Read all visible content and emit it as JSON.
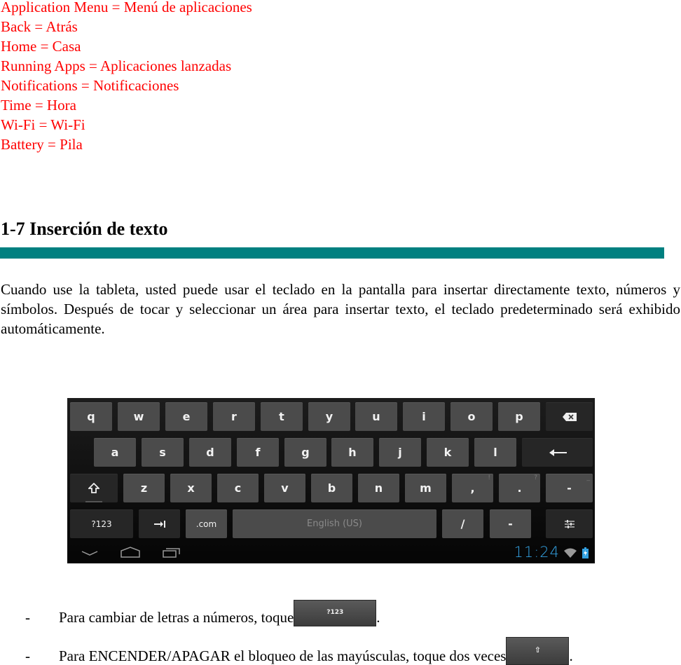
{
  "glossary": [
    "Application Menu = Menú de aplicaciones",
    "Back = Atrás",
    "Home = Casa",
    "Running Apps = Aplicaciones lanzadas",
    "Notifications = Notificaciones",
    "Time = Hora",
    "Wi-Fi = Wi-Fi",
    "Battery = Pila"
  ],
  "section": {
    "title": "1-7 Inserción de texto",
    "rule_color": "#008080",
    "paragraph": "Cuando use la tableta, usted puede usar el teclado en la pantalla para insertar directamente texto, números y símbolos. Después de tocar y seleccionar un área para insertar texto, el teclado predeterminado será exhibido automáticamente."
  },
  "keyboard": {
    "row1": [
      "q",
      "w",
      "e",
      "r",
      "t",
      "y",
      "u",
      "i",
      "o",
      "p"
    ],
    "row2": [
      "a",
      "s",
      "d",
      "f",
      "g",
      "h",
      "j",
      "k",
      "l"
    ],
    "row3": [
      "z",
      "x",
      "c",
      "v",
      "b",
      "n",
      "m",
      ",",
      ".",
      "-"
    ],
    "row3_hints": {
      "comma": "!",
      "period": "?",
      "dash": "_"
    },
    "symbols_key": "?123",
    "dotcom_key": ".com",
    "space_key": "English (US)",
    "slash_key": "/",
    "dash_key": "-",
    "backspace_icon": "backspace-icon",
    "enter_icon": "enter-icon",
    "shift_icon": "shift-icon",
    "tab_icon": "tab-icon",
    "settings_icon": "settings-sliders-icon",
    "status": {
      "time": "11:24",
      "clock_color": "#33a0e0"
    }
  },
  "bullets": [
    {
      "dash": "-",
      "text": "Para cambiar de letras a números, toque",
      "key_label": "?123",
      "end": "."
    },
    {
      "dash": "-",
      "text": "Para ENCENDER/APAGAR el bloqueo de las mayúsculas, toque dos veces",
      "key_label": "⇧",
      "end": "."
    }
  ]
}
